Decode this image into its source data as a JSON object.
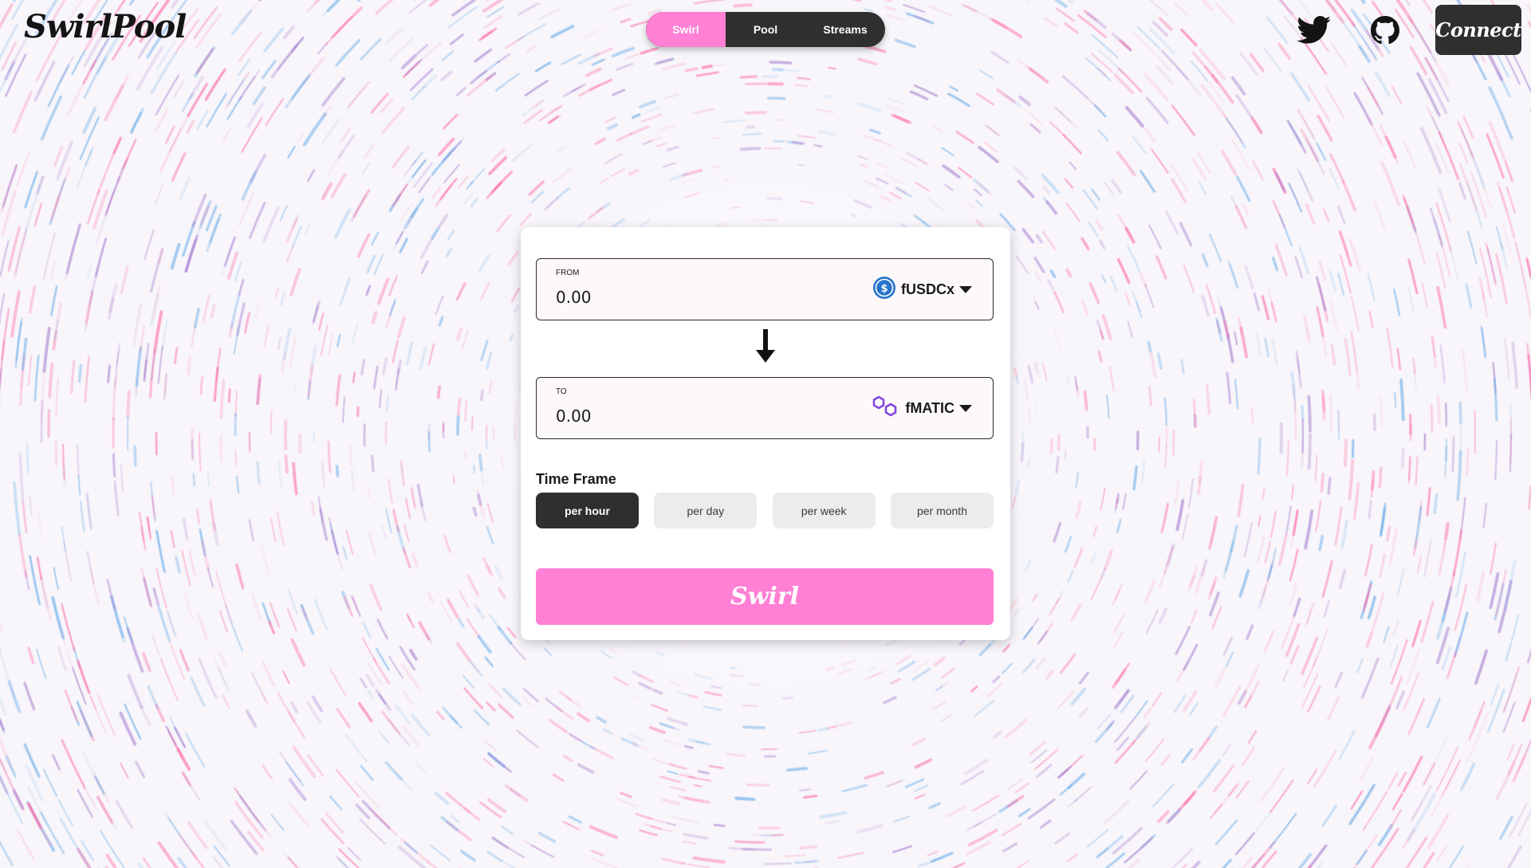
{
  "brand": {
    "logo_text": "SwirlPool"
  },
  "nav": {
    "tabs": [
      {
        "label": "Swirl",
        "active": true
      },
      {
        "label": "Pool",
        "active": false
      },
      {
        "label": "Streams",
        "active": false
      }
    ]
  },
  "header": {
    "social_icons": [
      "twitter-icon",
      "github-icon"
    ],
    "connect_label": "Connect"
  },
  "swap": {
    "from": {
      "label": "FROM",
      "amount": "0.00",
      "token": "fUSDCx",
      "token_icon": "usdc-icon"
    },
    "to": {
      "label": "TO",
      "amount": "0.00",
      "token": "fMATIC",
      "token_icon": "polygon-icon"
    },
    "direction_icon": "arrow-down-icon"
  },
  "timeframe": {
    "label": "Time Frame",
    "options": [
      {
        "label": "per hour",
        "active": true
      },
      {
        "label": "per day",
        "active": false
      },
      {
        "label": "per week",
        "active": false
      },
      {
        "label": "per month",
        "active": false
      }
    ]
  },
  "action": {
    "swirl_label": "Swirl"
  },
  "colors": {
    "accent_pink": "#ff80d5",
    "dark": "#2f2f2f",
    "usdc_blue": "#2775ca",
    "polygon_purple": "#8247e5"
  }
}
